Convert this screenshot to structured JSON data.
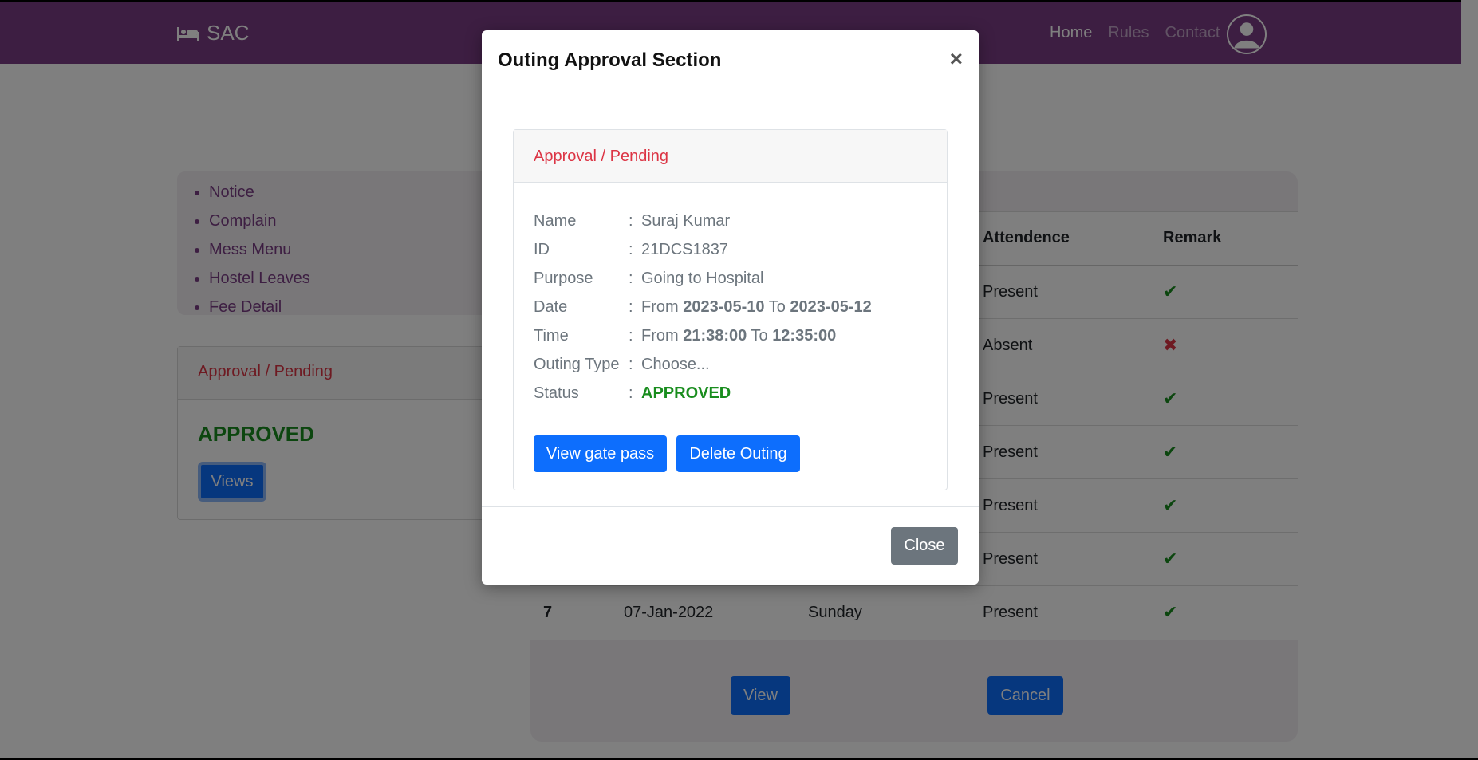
{
  "navbar": {
    "brand": "SAC",
    "links": [
      "Home",
      "Rules",
      "Contact"
    ]
  },
  "side_menu": {
    "items": [
      "Notice",
      "Complain",
      "Mess Menu",
      "Hostel Leaves",
      "Fee Detail"
    ]
  },
  "approval_card": {
    "header": "Approval / Pending",
    "status": "APPROVED",
    "views_label": "Views"
  },
  "attendance_table": {
    "headers": [
      "",
      "",
      "",
      "Attendence",
      "Remark"
    ],
    "rows": [
      {
        "no": "",
        "date": "",
        "day": "",
        "attendance": "Present",
        "remark": "check"
      },
      {
        "no": "",
        "date": "",
        "day": "",
        "attendance": "Absent",
        "remark": "cross"
      },
      {
        "no": "",
        "date": "",
        "day": "",
        "attendance": "Present",
        "remark": "check"
      },
      {
        "no": "",
        "date": "",
        "day": "",
        "attendance": "Present",
        "remark": "check"
      },
      {
        "no": "",
        "date": "",
        "day": "",
        "attendance": "Present",
        "remark": "check"
      },
      {
        "no": "",
        "date": "",
        "day": "",
        "attendance": "Present",
        "remark": "check"
      },
      {
        "no": "7",
        "date": "07-Jan-2022",
        "day": "Sunday",
        "attendance": "Present",
        "remark": "check"
      }
    ],
    "view_label": "View",
    "cancel_label": "Cancel"
  },
  "modal": {
    "title": "Outing Approval Section",
    "close_symbol": "×",
    "card_header": "Approval / Pending",
    "fields": {
      "name_label": "Name",
      "name_value": "Suraj Kumar",
      "id_label": "ID",
      "id_value": "21DCS1837",
      "purpose_label": "Purpose",
      "purpose_value": "Going to Hospital",
      "date_label": "Date",
      "date_from_word": "From",
      "date_from": "2023-05-10",
      "date_to_word": "To",
      "date_to": "2023-05-12",
      "time_label": "Time",
      "time_from_word": "From",
      "time_from": "21:38:00",
      "time_to_word": "To",
      "time_to": "12:35:00",
      "outing_type_label": "Outing Type",
      "outing_type_value": "Choose...",
      "status_label": "Status",
      "status_value": "APPROVED",
      "separator": ":"
    },
    "view_gate_pass_label": "View gate pass",
    "delete_outing_label": "Delete Outing",
    "close_label": "Close"
  },
  "colors": {
    "navbar": "#7b3d85",
    "primary": "#0d6efd",
    "danger": "#dc3545",
    "success": "#198d1e",
    "secondary": "#6c757d"
  }
}
